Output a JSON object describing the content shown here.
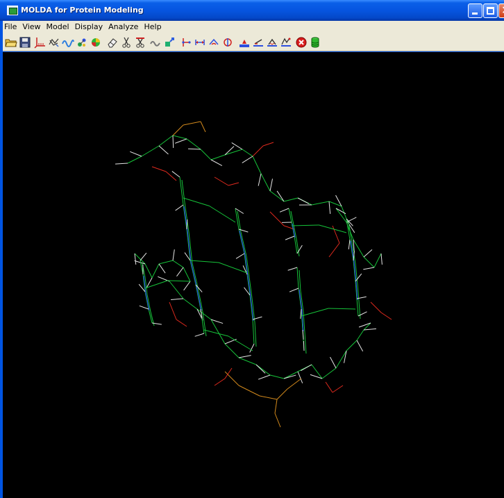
{
  "window": {
    "title": "MOLDA for Protein Modeling"
  },
  "menu": [
    {
      "label": "File"
    },
    {
      "label": "View"
    },
    {
      "label": "Model"
    },
    {
      "label": "Display"
    },
    {
      "label": "Analyze"
    },
    {
      "label": "Help"
    }
  ],
  "toolbar": [
    {
      "name": "open-file"
    },
    {
      "name": "save-file"
    },
    {
      "name": "axes"
    },
    {
      "name": "wireframe"
    },
    {
      "name": "ribbon"
    },
    {
      "name": "atoms-ball"
    },
    {
      "name": "sphere-color"
    },
    {
      "name": "eraser"
    },
    {
      "name": "cut-bond"
    },
    {
      "name": "cut-bond-red"
    },
    {
      "name": "link-chain"
    },
    {
      "name": "add-fragment"
    },
    {
      "name": "measure-distance"
    },
    {
      "name": "measure-length"
    },
    {
      "name": "measure-angle"
    },
    {
      "name": "measure-torsion"
    },
    {
      "name": "minimize"
    },
    {
      "name": "rotate-bond"
    },
    {
      "name": "superpose"
    },
    {
      "name": "surface"
    },
    {
      "name": "stop"
    },
    {
      "name": "database"
    }
  ],
  "colors": {
    "carbon": "#16c43a",
    "nitrogen": "#2a3cff",
    "oxygen": "#e02a1e",
    "sulfur": "#d48a1c",
    "hydrogen": "#e6e6e6",
    "background": "#000000"
  }
}
